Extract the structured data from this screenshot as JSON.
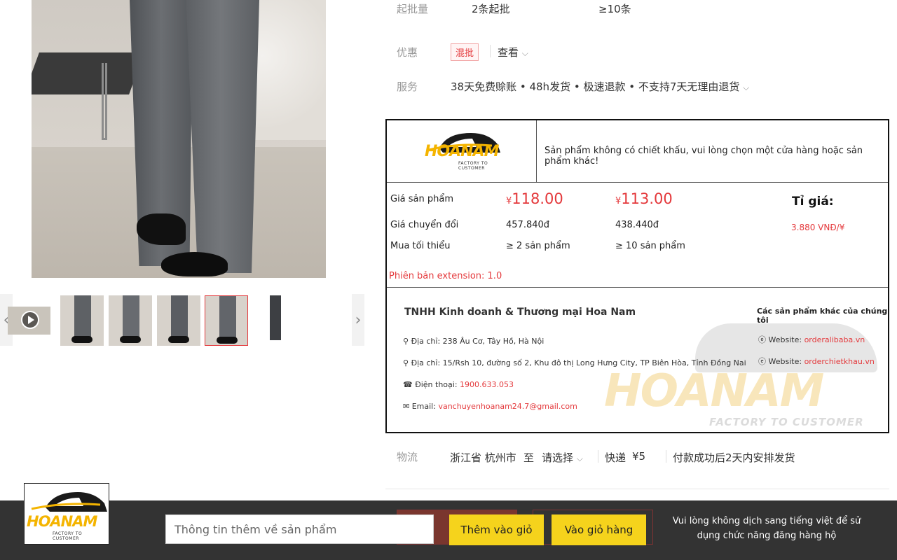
{
  "attributes": {
    "moq_label": "起批量",
    "moq_value1": "2条起批",
    "moq_value2": "≥10条",
    "promo_label": "优惠",
    "promo_tag": "混批",
    "promo_link": "查看",
    "service_label": "服务",
    "service_value": "38天免费赊账 • 48h发货 • 极速退款 • 不支持7天无理由退货"
  },
  "hoanam_panel": {
    "logo_text": "HOANAM",
    "logo_sub": "FACTORY TO CUSTOMER",
    "notice": "Sản phẩm không có chiết khấu, vui lòng chọn một cửa hàng hoặc sản phẩm khác!",
    "row_labels": [
      "Giá sản phẩm",
      "Giá chuyển đổi",
      "Mua tối thiểu"
    ],
    "tier1": {
      "price_symbol": "¥",
      "price": "118.00",
      "converted": "457.840đ",
      "min": "≥ 2 sản phẩm"
    },
    "tier2": {
      "price_symbol": "¥",
      "price": "113.00",
      "converted": "438.440đ",
      "min": "≥ 10 sản phẩm"
    },
    "rate_title": "Tỉ giá:",
    "rate_value": "3.880 VNĐ/¥",
    "version": "Phiên bản extension: 1.0",
    "company": "TNHH Kinh doanh & Thương mại Hoa Nam",
    "address1": "Địa chỉ: 238 Âu Cơ, Tây Hồ, Hà Nội",
    "address2": "Địa chỉ: 15/Rsh 10, đường số 2, Khu đô thị Long Hưng City, TP Biên Hòa, Tỉnh Đồng Nai",
    "phone_label": "Điện thoại:",
    "phone": "1900.633.053",
    "email_label": "Email:",
    "email": "vanchuyenhoanam24.7@gmail.com",
    "other_title": "Các sản phẩm khác của chúng tôi",
    "website_label": "Website:",
    "website1": "orderalibaba.vn",
    "website2": "orderchietkhau.vn",
    "watermark_text": "HOANAM",
    "watermark_sub": "FACTORY TO CUSTOMER"
  },
  "logistics": {
    "label": "物流",
    "origin": "浙江省 杭州市",
    "to": "至",
    "select": "请选择",
    "express": "快递",
    "fee": "¥5",
    "note": "付款成功后2天内安排发货"
  },
  "toolbar": {
    "logo_text": "HOANAM",
    "logo_sub": "FACTORY TO CUSTOMER",
    "input_placeholder": "Thông tin thêm về sản phẩm",
    "add_to_cart": "Thêm vào giỏ",
    "go_to_cart": "Vào giỏ hàng",
    "warning": "Vui lòng không dịch sang tiếng việt để sử dụng chức năng đăng hàng hộ"
  },
  "colors": {
    "accent_red": "#e4393c",
    "toolbar_bg": "#333333",
    "button_yellow": "#f5d31c",
    "logo_gold": "#f4b400"
  },
  "icons": [
    "play-icon",
    "chevron-left-icon",
    "chevron-right-icon",
    "chevron-down-icon",
    "location-icon",
    "phone-icon",
    "email-icon",
    "globe-icon"
  ]
}
